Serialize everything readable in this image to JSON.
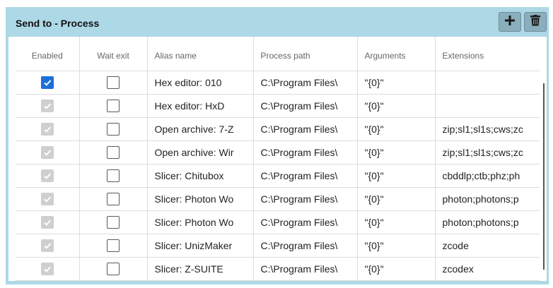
{
  "panel": {
    "title": "Send to - Process",
    "add_icon": "plus-icon",
    "delete_icon": "trash-icon",
    "accent_color": "#add8e6"
  },
  "columns": {
    "enabled": "Enabled",
    "wait_exit": "Wait exit",
    "alias": "Alias name",
    "path": "Process path",
    "arguments": "Arguments",
    "extensions": "Extensions"
  },
  "rows": [
    {
      "enabled": true,
      "enabled_editable": true,
      "wait_exit": false,
      "alias": "Hex editor: 010",
      "path": "C:\\Program Files\\",
      "arguments": "\"{0}\"",
      "extensions": ""
    },
    {
      "enabled": true,
      "enabled_editable": false,
      "wait_exit": false,
      "alias": "Hex editor: HxD",
      "path": "C:\\Program Files\\",
      "arguments": "\"{0}\"",
      "extensions": ""
    },
    {
      "enabled": true,
      "enabled_editable": false,
      "wait_exit": false,
      "alias": "Open archive: 7-Z",
      "path": "C:\\Program Files\\",
      "arguments": "\"{0}\"",
      "extensions": "zip;sl1;sl1s;cws;zc"
    },
    {
      "enabled": true,
      "enabled_editable": false,
      "wait_exit": false,
      "alias": "Open archive: Wir",
      "path": "C:\\Program Files\\",
      "arguments": "\"{0}\"",
      "extensions": "zip;sl1;sl1s;cws;zc"
    },
    {
      "enabled": true,
      "enabled_editable": false,
      "wait_exit": false,
      "alias": "Slicer: Chitubox",
      "path": "C:\\Program Files\\",
      "arguments": "\"{0}\"",
      "extensions": "cbddlp;ctb;phz;ph"
    },
    {
      "enabled": true,
      "enabled_editable": false,
      "wait_exit": false,
      "alias": "Slicer: Photon Wo",
      "path": "C:\\Program Files\\",
      "arguments": "\"{0}\"",
      "extensions": "photon;photons;p"
    },
    {
      "enabled": true,
      "enabled_editable": false,
      "wait_exit": false,
      "alias": "Slicer: Photon Wo",
      "path": "C:\\Program Files\\",
      "arguments": "\"{0}\"",
      "extensions": "photon;photons;p"
    },
    {
      "enabled": true,
      "enabled_editable": false,
      "wait_exit": false,
      "alias": "Slicer: UnizMaker",
      "path": "C:\\Program Files\\",
      "arguments": "\"{0}\"",
      "extensions": "zcode"
    },
    {
      "enabled": true,
      "enabled_editable": false,
      "wait_exit": false,
      "alias": "Slicer: Z-SUITE",
      "path": "C:\\Program Files\\",
      "arguments": "\"{0}\"",
      "extensions": "zcodex"
    }
  ]
}
